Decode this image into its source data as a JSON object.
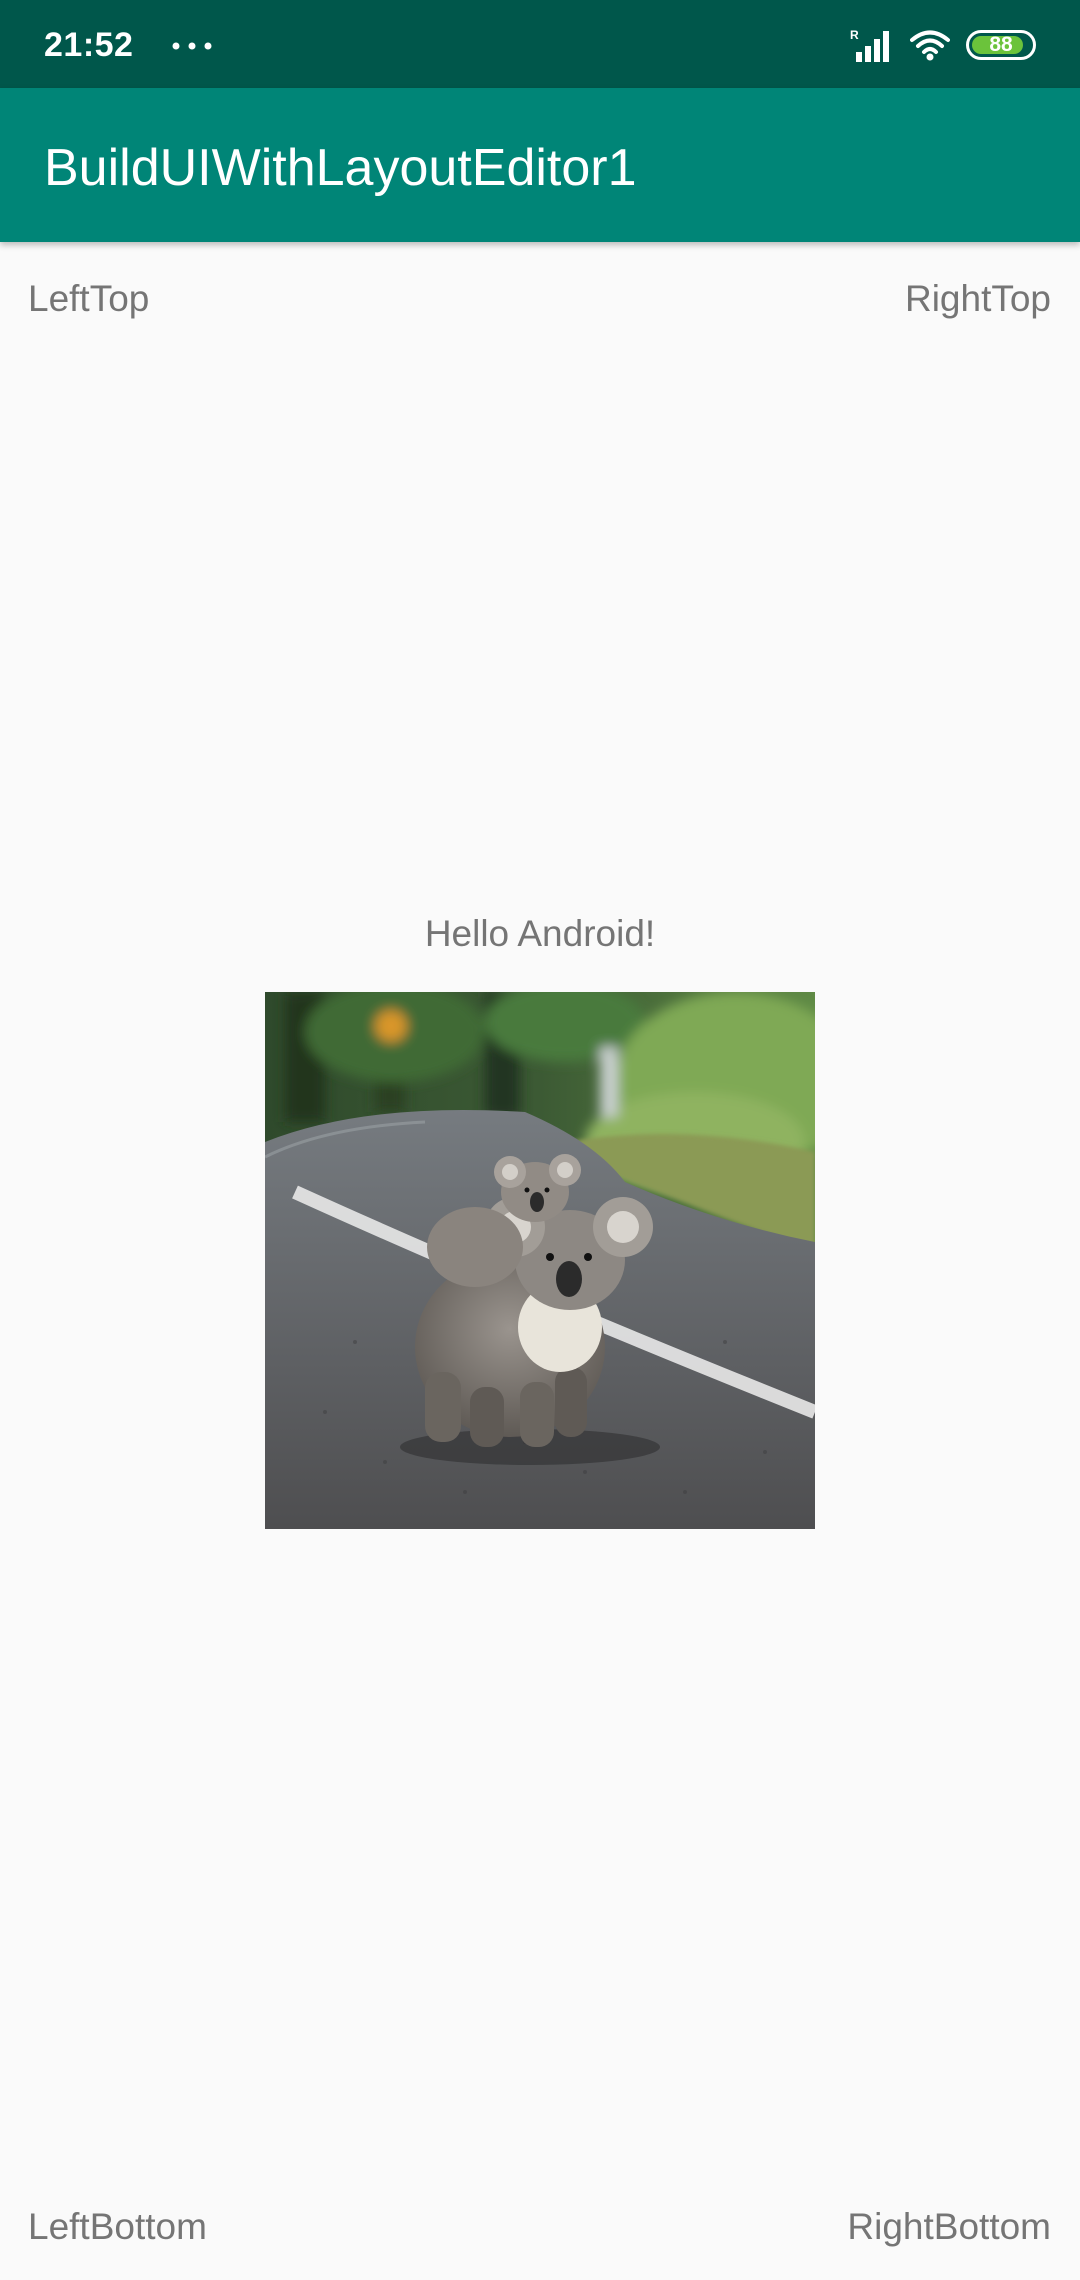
{
  "status_bar": {
    "time": "21:52",
    "battery_percent": 88,
    "battery_label": "88",
    "icons": [
      "more-dots-icon",
      "signal-roaming-icon",
      "wifi-icon",
      "battery-icon"
    ]
  },
  "app_bar": {
    "title": "BuildUIWithLayoutEditor1"
  },
  "labels": {
    "left_top": "LeftTop",
    "right_top": "RightTop",
    "center": "Hello Android!",
    "left_bottom": "LeftBottom",
    "right_bottom": "RightBottom"
  },
  "image": {
    "subject": "koala-photo"
  },
  "colors": {
    "status_bar": "#00574b",
    "app_bar": "#008577",
    "background": "#fafafa",
    "label_text": "#757575",
    "battery_fill": "#6bc33b"
  }
}
